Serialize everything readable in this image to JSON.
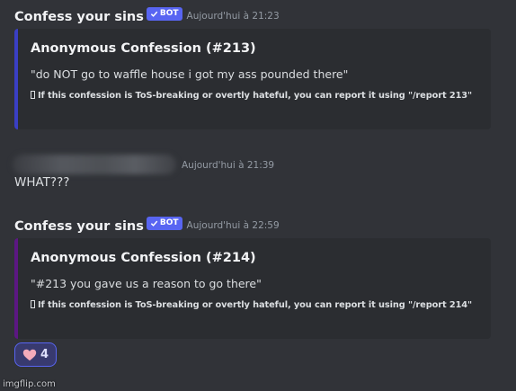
{
  "messages": [
    {
      "author": "Confess your sins",
      "badge": "BOT",
      "timestamp": "Aujourd'hui à 21:23",
      "embed": {
        "title": "Anonymous Confession (#213)",
        "quote": "\"do NOT go to waffle house i got my ass pounded there\"",
        "footer": "If this confession is ToS-breaking or overtly hateful, you can report it using \"/report 213\"",
        "accent_color": "#3a3fc4"
      }
    },
    {
      "author": "",
      "timestamp": "Aujourd'hui à 21:39",
      "content": "WHAT???"
    },
    {
      "author": "Confess your sins",
      "badge": "BOT",
      "timestamp": "Aujourd'hui à 22:59",
      "embed": {
        "title": "Anonymous Confession (#214)",
        "quote": "\"#213 you gave us a reason to go there\"",
        "footer": "If this confession is ToS-breaking or overtly hateful, you can report it using \"/report 214\"",
        "accent_color": "#5c1783"
      },
      "reaction": {
        "icon": "pink-heart-icon",
        "count": "4"
      }
    }
  ],
  "watermark": "imgflip.com",
  "colors": {
    "background": "#313338",
    "embed_background": "#2b2d31",
    "bot_badge": "#5865f2",
    "reaction_border": "#5865f2"
  }
}
